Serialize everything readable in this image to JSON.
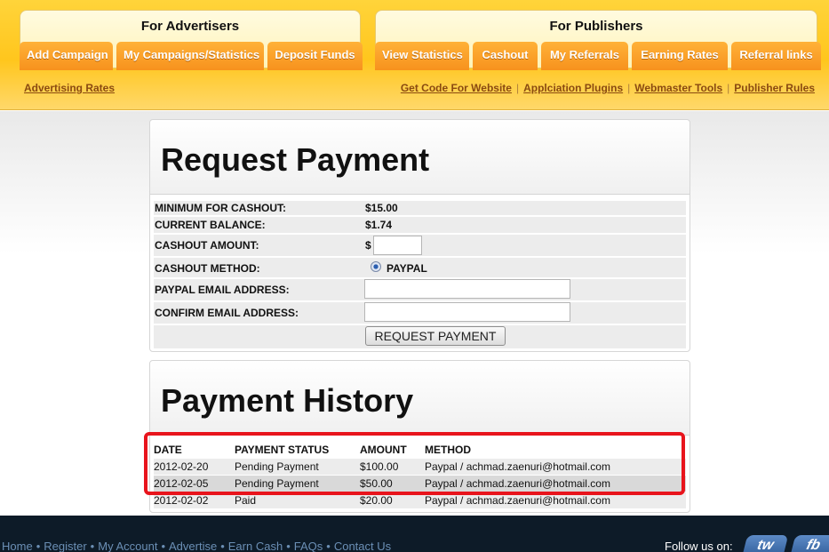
{
  "header": {
    "advertisers": {
      "title": "For Advertisers",
      "tabs": [
        "Add Campaign",
        "My Campaigns/Statistics",
        "Deposit Funds"
      ],
      "sublink": "Advertising Rates"
    },
    "publishers": {
      "title": "For Publishers",
      "tabs": [
        "View Statistics",
        "Cashout",
        "My Referrals",
        "Earning Rates",
        "Referral links"
      ],
      "sublinks": [
        "Get Code For Website",
        "Applciation Plugins",
        "Webmaster Tools",
        "Publisher Rules"
      ],
      "separator": "|"
    }
  },
  "request_payment": {
    "title": "Request Payment",
    "min_cashout_label": "MINIMUM FOR CASHOUT:",
    "min_cashout_value": "$15.00",
    "balance_label": "CURRENT BALANCE:",
    "balance_value": "$1.74",
    "amount_label": "CASHOUT AMOUNT:",
    "amount_prefix": "$",
    "amount_value": "",
    "method_label": "CASHOUT METHOD:",
    "method_option": "PAYPAL",
    "paypal_email_label": "PAYPAL EMAIL ADDRESS:",
    "paypal_email_value": "",
    "confirm_email_label": "CONFIRM EMAIL ADDRESS:",
    "confirm_email_value": "",
    "submit_label": "REQUEST PAYMENT"
  },
  "payment_history": {
    "title": "Payment History",
    "columns": [
      "DATE",
      "PAYMENT STATUS",
      "AMOUNT",
      "METHOD"
    ],
    "rows": [
      [
        "2012-02-20",
        "Pending Payment",
        "$100.00",
        "Paypal / achmad.zaenuri@hotmail.com"
      ],
      [
        "2012-02-05",
        "Pending Payment",
        "$50.00",
        "Paypal / achmad.zaenuri@hotmail.com"
      ],
      [
        "2012-02-02",
        "Paid",
        "$20.00",
        "Paypal / achmad.zaenuri@hotmail.com"
      ]
    ]
  },
  "footer": {
    "links": [
      "Home",
      "Register",
      "My Account",
      "Advertise",
      "Earn Cash",
      "FAQs",
      "Contact Us"
    ],
    "dot": "•",
    "follow_text": "Follow us on:",
    "social": [
      "tw",
      "fb"
    ]
  },
  "colors": {
    "header_yellow": "#ffc61d",
    "tab_orange": "#f7921d",
    "footer_bg": "#0d1b28",
    "highlight_red": "#e8141c"
  }
}
